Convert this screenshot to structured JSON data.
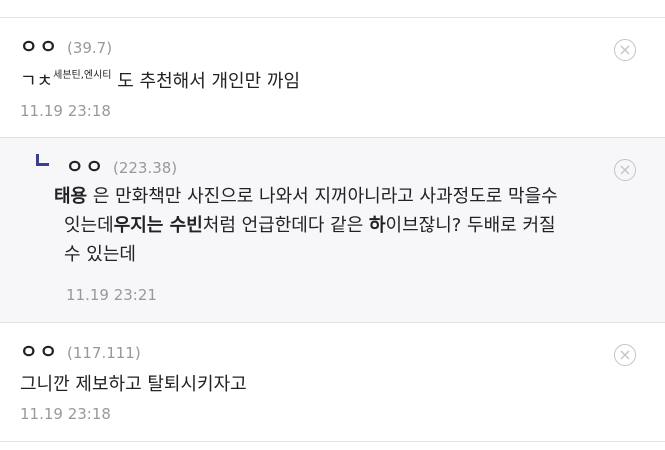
{
  "comments": [
    {
      "nick": "ㅇㅇ",
      "score": "(39.7)",
      "parts": {
        "a": "ㄱㅊ",
        "sup": "세븐틴,엔시티",
        "b": " 도 추천해서 개인만 까임"
      },
      "date": "11.19 23:18",
      "delete_icon": "×"
    },
    {
      "nick": "ㅇㅇ",
      "score": "(223.38)",
      "is_reply": true,
      "parts": {
        "bold1": "태용",
        "t1": " 은 만화책만 사진으로 나와서 지꺼아니라고 사과정도로 막을수",
        "t2a": "잇는데",
        "bold2": "우지는 수빈",
        "t2b": "처럼 언급한데다 같은",
        "bold3": "하",
        "t2c": "이브잖니? 두배로 커질",
        "t3": "수 있는데"
      },
      "date": "11.19 23:21",
      "delete_icon": "×"
    },
    {
      "nick": "ㅇㅇ",
      "score": "(117.111)",
      "text": "그니깐 제보하고 탈퇴시키자고",
      "date": "11.19 23:18",
      "delete_icon": "×"
    }
  ]
}
